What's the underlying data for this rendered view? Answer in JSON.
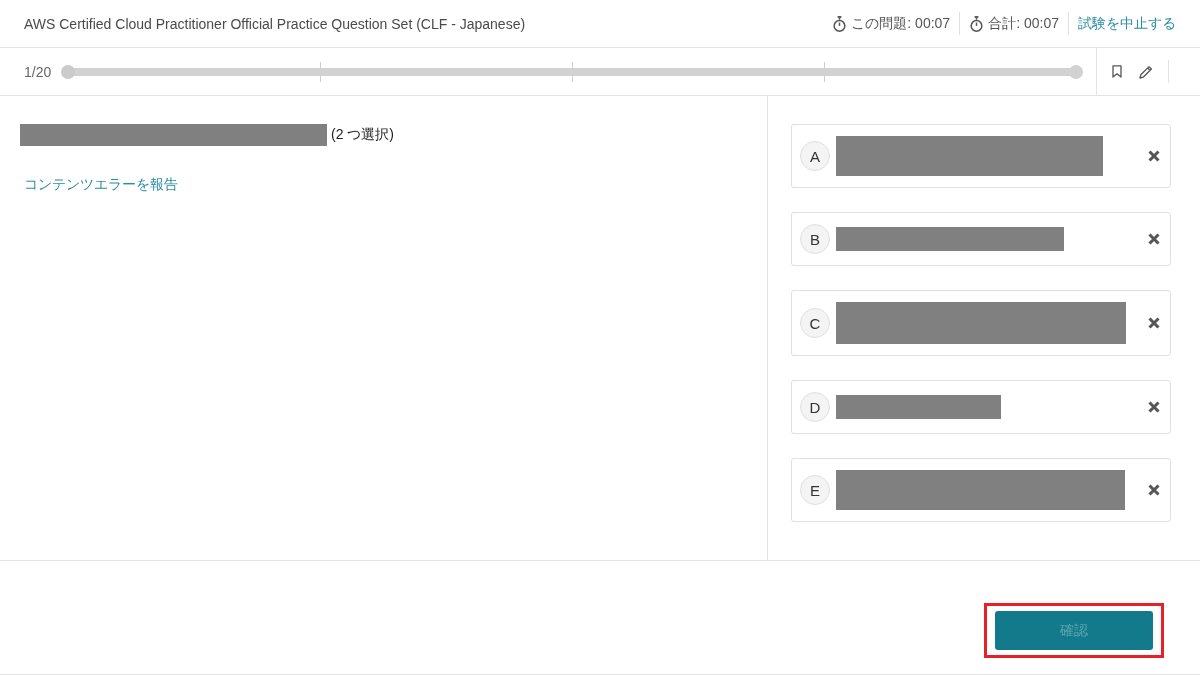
{
  "header": {
    "title": "AWS Certified Cloud Practitioner Official Practice Question Set (CLF - Japanese)",
    "timers": [
      {
        "label": "この問題: 00:07"
      },
      {
        "label": "合計: 00:07"
      }
    ],
    "quit_link": "試験を中止する"
  },
  "progress": {
    "counter": "1/20",
    "level": 0
  },
  "question": {
    "selection_note": "(2 つ選択)",
    "report_link": "コンテンツエラーを報告"
  },
  "options": [
    {
      "letter": "A",
      "selected": false
    },
    {
      "letter": "B",
      "selected": false
    },
    {
      "letter": "C",
      "selected": false
    },
    {
      "letter": "D",
      "selected": false
    },
    {
      "letter": "E",
      "selected": false
    }
  ],
  "confirm_button": {
    "label": "確認",
    "disabled": true,
    "highlighted": true
  }
}
